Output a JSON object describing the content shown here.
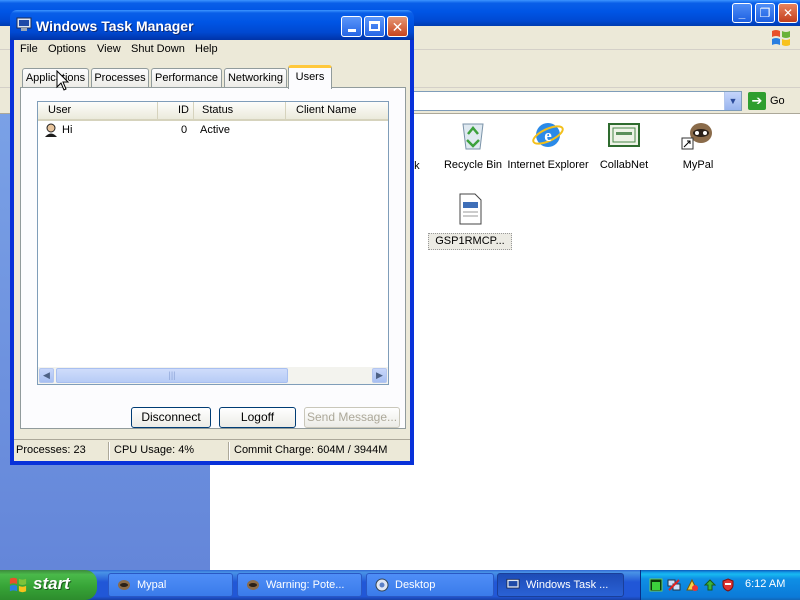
{
  "colors": {
    "titlebar": "#0055e5",
    "window_frame": "#0831d9",
    "dialog_bg": "#ece9d8",
    "active_tab_accent": "#ffc83c",
    "taskbar": "#2157d7",
    "start_button": "#37a437"
  },
  "explorer": {
    "address_go_label": "Go",
    "desktop_icons": [
      {
        "label": "ork",
        "icon": "network-icon"
      },
      {
        "label": "Recycle Bin",
        "icon": "recycle-bin-icon"
      },
      {
        "label": "Internet Explorer",
        "icon": "internet-explorer-icon"
      },
      {
        "label": "CollabNet",
        "icon": "collabnet-icon"
      },
      {
        "label": "MyPal",
        "icon": "mypal-icon"
      },
      {
        "label": "GSP1RMCP...",
        "icon": "document-icon"
      }
    ]
  },
  "task_manager": {
    "title": "Windows Task Manager",
    "menu": [
      "File",
      "Options",
      "View",
      "Shut Down",
      "Help"
    ],
    "tabs": [
      "Applications",
      "Processes",
      "Performance",
      "Networking",
      "Users"
    ],
    "active_tab": "Users",
    "columns": [
      "User",
      "ID",
      "Status",
      "Client Name"
    ],
    "rows": [
      {
        "user": "Hi",
        "id": "0",
        "status": "Active",
        "client_name": ""
      }
    ],
    "buttons": {
      "disconnect": "Disconnect",
      "logoff": "Logoff",
      "send_message": "Send Message..."
    },
    "status_bar": {
      "processes": "Processes: 23",
      "cpu": "CPU Usage: 4%",
      "commit": "Commit Charge: 604M / 3944M"
    }
  },
  "taskbar": {
    "start_label": "start",
    "buttons": [
      {
        "label": "Mypal",
        "icon": "mypal-icon"
      },
      {
        "label": "Warning: Pote...",
        "icon": "warning-icon"
      },
      {
        "label": "Desktop",
        "icon": "desktop-icon"
      },
      {
        "label": "Windows Task ...",
        "icon": "task-manager-icon"
      }
    ],
    "clock": "6:12 AM"
  }
}
